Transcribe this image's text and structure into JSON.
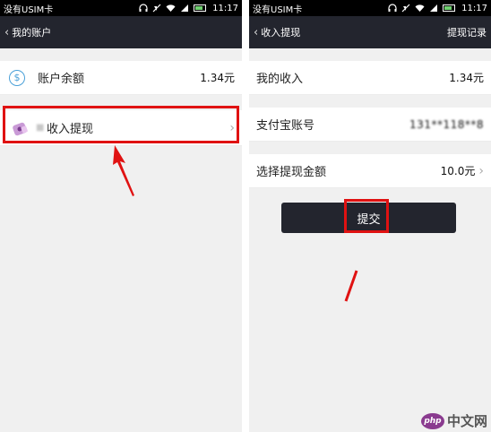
{
  "screen1": {
    "status": {
      "carrier": "没有USIM卡",
      "time": "11:17",
      "battery_level": 0.75
    },
    "header": {
      "title": "我的账户"
    },
    "rows": [
      {
        "label": "账户余额",
        "value": "1.34元",
        "icon": "dollar-coin-icon"
      },
      {
        "label": "收入提现",
        "icon": "purse-icon"
      }
    ]
  },
  "screen2": {
    "status": {
      "carrier": "没有USIM卡",
      "time": "11:17",
      "battery_level": 0.75
    },
    "header": {
      "title": "收入提现",
      "action": "提现记录"
    },
    "rows": [
      {
        "label": "我的收入",
        "value": "1.34元"
      },
      {
        "label": "支付宝账号",
        "value": "131**118**8"
      },
      {
        "label": "选择提现金额",
        "value": "10.0元"
      }
    ],
    "submit_label": "提交"
  },
  "watermark": {
    "logo_text": "php",
    "text": "中文网"
  },
  "colors": {
    "highlight": "#e01212",
    "header_bg": "#23252e",
    "accent": "#4aa0d8"
  }
}
